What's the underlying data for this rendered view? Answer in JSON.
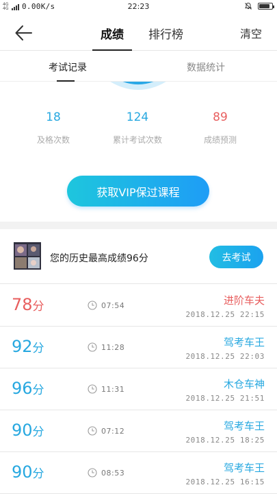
{
  "status_bar": {
    "network_tag": "4G 4G",
    "speed": "0.00K/s",
    "time": "22:23",
    "battery_level": 0.85
  },
  "header": {
    "tabs": [
      {
        "label": "成绩",
        "active": true
      },
      {
        "label": "排行榜",
        "active": false
      }
    ],
    "clear_label": "清空"
  },
  "subtabs": [
    {
      "label": "考试记录",
      "active": true
    },
    {
      "label": "数据统计",
      "active": false
    }
  ],
  "stats": [
    {
      "value": "18",
      "label": "及格次数",
      "color": "#27a8e0"
    },
    {
      "value": "124",
      "label": "累计考试次数",
      "color": "#27a8e0"
    },
    {
      "value": "89",
      "label": "成绩预测",
      "color": "#e85e5e"
    }
  ],
  "vip_button": "获取VIP保过课程",
  "best": {
    "text": "您的历史最高成绩96分",
    "button": "去考试"
  },
  "records": [
    {
      "score": "78",
      "unit": "分",
      "score_color": "red",
      "duration": "07:54",
      "rank": "进阶车夫",
      "rank_color": "red",
      "date": "2018.12.25 22:15"
    },
    {
      "score": "92",
      "unit": "分",
      "score_color": "blue",
      "duration": "11:28",
      "rank": "驾考车王",
      "rank_color": "blue",
      "date": "2018.12.25 22:03"
    },
    {
      "score": "96",
      "unit": "分",
      "score_color": "blue",
      "duration": "11:31",
      "rank": "木仓车神",
      "rank_color": "blue",
      "date": "2018.12.25 21:51"
    },
    {
      "score": "90",
      "unit": "分",
      "score_color": "blue",
      "duration": "07:12",
      "rank": "驾考车王",
      "rank_color": "blue",
      "date": "2018.12.25 18:25"
    },
    {
      "score": "90",
      "unit": "分",
      "score_color": "blue",
      "duration": "08:53",
      "rank": "驾考车王",
      "rank_color": "blue",
      "date": "2018.12.25 16:15"
    }
  ],
  "colors": {
    "accent_blue": "#27a8e0",
    "accent_red": "#e85e5e",
    "gradient_start": "#1ec6dd",
    "gradient_end": "#1e9df6"
  }
}
